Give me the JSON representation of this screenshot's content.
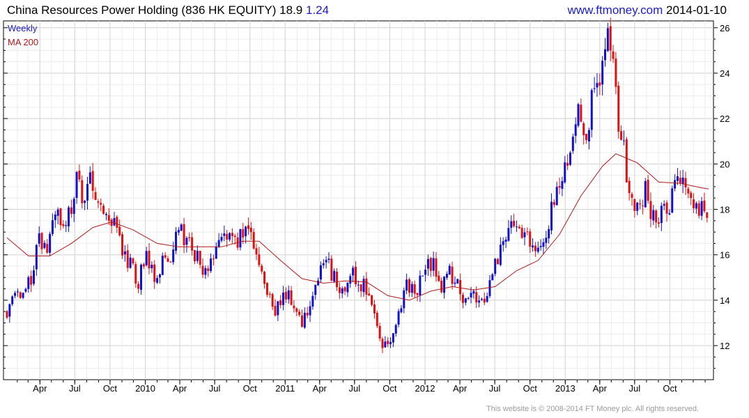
{
  "header": {
    "title": "China Resources Power Holding (836 HK EQUITY)",
    "last_price": "18.9",
    "change": "1.24",
    "site": "www.ftmoney.com",
    "date": "2014-01-10"
  },
  "footer": {
    "copyright": "This website is © 2008-2014 FT Money plc. All rights reserved."
  },
  "colors": {
    "up": "#1010d0",
    "down": "#e01010",
    "ma": "#b01818",
    "grid": "#dcdcdc",
    "axis": "#000000"
  },
  "chart_data": {
    "type": "candlestick",
    "frequency_label": "Weekly",
    "moving_average_label": "MA 200",
    "ylim": [
      10.5,
      26.3
    ],
    "y_ticks": [
      12,
      14,
      16,
      18,
      20,
      22,
      24,
      26
    ],
    "x_range": [
      "2009-01-05",
      "2014-01-10"
    ],
    "x_ticks": [
      {
        "date": "2009-04-01",
        "label": "Apr"
      },
      {
        "date": "2009-07-01",
        "label": "Jul"
      },
      {
        "date": "2009-10-01",
        "label": "Oct"
      },
      {
        "date": "2010-01-01",
        "label": "2010"
      },
      {
        "date": "2010-04-01",
        "label": "Apr"
      },
      {
        "date": "2010-07-01",
        "label": "Jul"
      },
      {
        "date": "2010-10-01",
        "label": "Oct"
      },
      {
        "date": "2011-01-01",
        "label": "2011"
      },
      {
        "date": "2011-04-01",
        "label": "Apr"
      },
      {
        "date": "2011-07-01",
        "label": "Jul"
      },
      {
        "date": "2011-10-01",
        "label": "Oct"
      },
      {
        "date": "2012-01-01",
        "label": "2012"
      },
      {
        "date": "2012-04-01",
        "label": "Apr"
      },
      {
        "date": "2012-07-01",
        "label": "Jul"
      },
      {
        "date": "2012-10-01",
        "label": "Oct"
      },
      {
        "date": "2013-01-01",
        "label": "2013"
      },
      {
        "date": "2013-04-01",
        "label": "Apr"
      },
      {
        "date": "2013-07-01",
        "label": "Jul"
      },
      {
        "date": "2013-10-01",
        "label": "Oct"
      }
    ],
    "close_path": [
      [
        "2009-01-05",
        13.5
      ],
      [
        "2009-01-26",
        14.2
      ],
      [
        "2009-02-16",
        14.0
      ],
      [
        "2009-03-09",
        15.0
      ],
      [
        "2009-03-30",
        16.6
      ],
      [
        "2009-04-20",
        16.2
      ],
      [
        "2009-05-11",
        17.6
      ],
      [
        "2009-06-01",
        17.4
      ],
      [
        "2009-06-22",
        18.0
      ],
      [
        "2009-07-06",
        19.7
      ],
      [
        "2009-07-20",
        18.4
      ],
      [
        "2009-08-10",
        19.3
      ],
      [
        "2009-08-31",
        17.9
      ],
      [
        "2009-09-21",
        17.5
      ],
      [
        "2009-10-12",
        17.3
      ],
      [
        "2009-11-02",
        16.3
      ],
      [
        "2009-11-23",
        15.5
      ],
      [
        "2009-12-14",
        14.8
      ],
      [
        "2010-01-04",
        15.9
      ],
      [
        "2010-01-25",
        14.9
      ],
      [
        "2010-02-15",
        15.8
      ],
      [
        "2010-03-08",
        16.0
      ],
      [
        "2010-03-29",
        17.2
      ],
      [
        "2010-04-19",
        16.5
      ],
      [
        "2010-05-10",
        16.0
      ],
      [
        "2010-05-31",
        15.3
      ],
      [
        "2010-06-21",
        15.6
      ],
      [
        "2010-07-12",
        16.6
      ],
      [
        "2010-08-02",
        17.0
      ],
      [
        "2010-08-23",
        16.6
      ],
      [
        "2010-09-13",
        17.0
      ],
      [
        "2010-10-04",
        17.2
      ],
      [
        "2010-10-25",
        15.6
      ],
      [
        "2010-11-15",
        14.3
      ],
      [
        "2010-12-06",
        13.5
      ],
      [
        "2011-01-03",
        14.3
      ],
      [
        "2011-01-24",
        13.6
      ],
      [
        "2011-02-14",
        12.8
      ],
      [
        "2011-03-07",
        13.9
      ],
      [
        "2011-03-28",
        15.0
      ],
      [
        "2011-04-18",
        15.8
      ],
      [
        "2011-05-09",
        14.9
      ],
      [
        "2011-05-30",
        14.3
      ],
      [
        "2011-06-20",
        15.2
      ],
      [
        "2011-07-11",
        14.8
      ],
      [
        "2011-08-01",
        14.5
      ],
      [
        "2011-08-22",
        13.5
      ],
      [
        "2011-09-12",
        12.2
      ],
      [
        "2011-10-03",
        12.0
      ],
      [
        "2011-10-24",
        13.6
      ],
      [
        "2011-11-14",
        14.8
      ],
      [
        "2011-12-05",
        14.2
      ],
      [
        "2012-01-02",
        15.4
      ],
      [
        "2012-01-23",
        15.6
      ],
      [
        "2012-02-13",
        14.6
      ],
      [
        "2012-03-05",
        15.2
      ],
      [
        "2012-03-26",
        14.7
      ],
      [
        "2012-04-16",
        13.8
      ],
      [
        "2012-05-07",
        14.1
      ],
      [
        "2012-05-28",
        13.8
      ],
      [
        "2012-06-18",
        14.8
      ],
      [
        "2012-07-09",
        16.0
      ],
      [
        "2012-07-30",
        16.6
      ],
      [
        "2012-08-20",
        17.3
      ],
      [
        "2012-09-10",
        16.8
      ],
      [
        "2012-10-01",
        16.6
      ],
      [
        "2012-10-22",
        15.9
      ],
      [
        "2012-11-12",
        17.0
      ],
      [
        "2012-12-03",
        18.3
      ],
      [
        "2012-12-24",
        19.3
      ],
      [
        "2013-01-14",
        20.4
      ],
      [
        "2013-02-04",
        22.7
      ],
      [
        "2013-02-25",
        21.4
      ],
      [
        "2013-03-18",
        23.3
      ],
      [
        "2013-04-08",
        24.2
      ],
      [
        "2013-04-22",
        25.5
      ],
      [
        "2013-05-06",
        24.4
      ],
      [
        "2013-05-20",
        21.7
      ],
      [
        "2013-06-03",
        20.5
      ],
      [
        "2013-06-17",
        18.8
      ],
      [
        "2013-07-08",
        17.9
      ],
      [
        "2013-07-29",
        18.8
      ],
      [
        "2013-08-19",
        17.6
      ],
      [
        "2013-09-09",
        17.9
      ],
      [
        "2013-09-30",
        18.2
      ],
      [
        "2013-10-14",
        19.6
      ],
      [
        "2013-11-04",
        19.4
      ],
      [
        "2013-11-25",
        18.4
      ],
      [
        "2013-12-16",
        17.9
      ],
      [
        "2014-01-06",
        18.0
      ],
      [
        "2014-01-10",
        18.9
      ]
    ],
    "moving_average": [
      [
        "2009-01-05",
        16.75
      ],
      [
        "2009-03-02",
        15.95
      ],
      [
        "2009-04-27",
        15.95
      ],
      [
        "2009-06-22",
        16.5
      ],
      [
        "2009-08-17",
        17.2
      ],
      [
        "2009-10-05",
        17.45
      ],
      [
        "2009-11-30",
        17.1
      ],
      [
        "2010-02-01",
        16.5
      ],
      [
        "2010-03-29",
        16.35
      ],
      [
        "2010-05-24",
        16.35
      ],
      [
        "2010-07-19",
        16.35
      ],
      [
        "2010-09-13",
        16.6
      ],
      [
        "2010-10-25",
        16.6
      ],
      [
        "2010-12-20",
        15.75
      ],
      [
        "2011-02-14",
        14.95
      ],
      [
        "2011-04-11",
        14.75
      ],
      [
        "2011-06-06",
        14.85
      ],
      [
        "2011-08-01",
        14.8
      ],
      [
        "2011-09-26",
        14.2
      ],
      [
        "2011-11-21",
        14.0
      ],
      [
        "2012-01-16",
        14.4
      ],
      [
        "2012-03-12",
        14.6
      ],
      [
        "2012-05-07",
        14.45
      ],
      [
        "2012-07-02",
        14.6
      ],
      [
        "2012-08-27",
        15.3
      ],
      [
        "2012-10-22",
        15.75
      ],
      [
        "2012-12-17",
        16.9
      ],
      [
        "2013-02-11",
        18.6
      ],
      [
        "2013-04-08",
        19.9
      ],
      [
        "2013-05-13",
        20.45
      ],
      [
        "2013-07-08",
        20.05
      ],
      [
        "2013-09-02",
        19.2
      ],
      [
        "2013-10-28",
        19.15
      ],
      [
        "2013-12-23",
        18.95
      ],
      [
        "2014-01-10",
        18.9
      ]
    ]
  }
}
